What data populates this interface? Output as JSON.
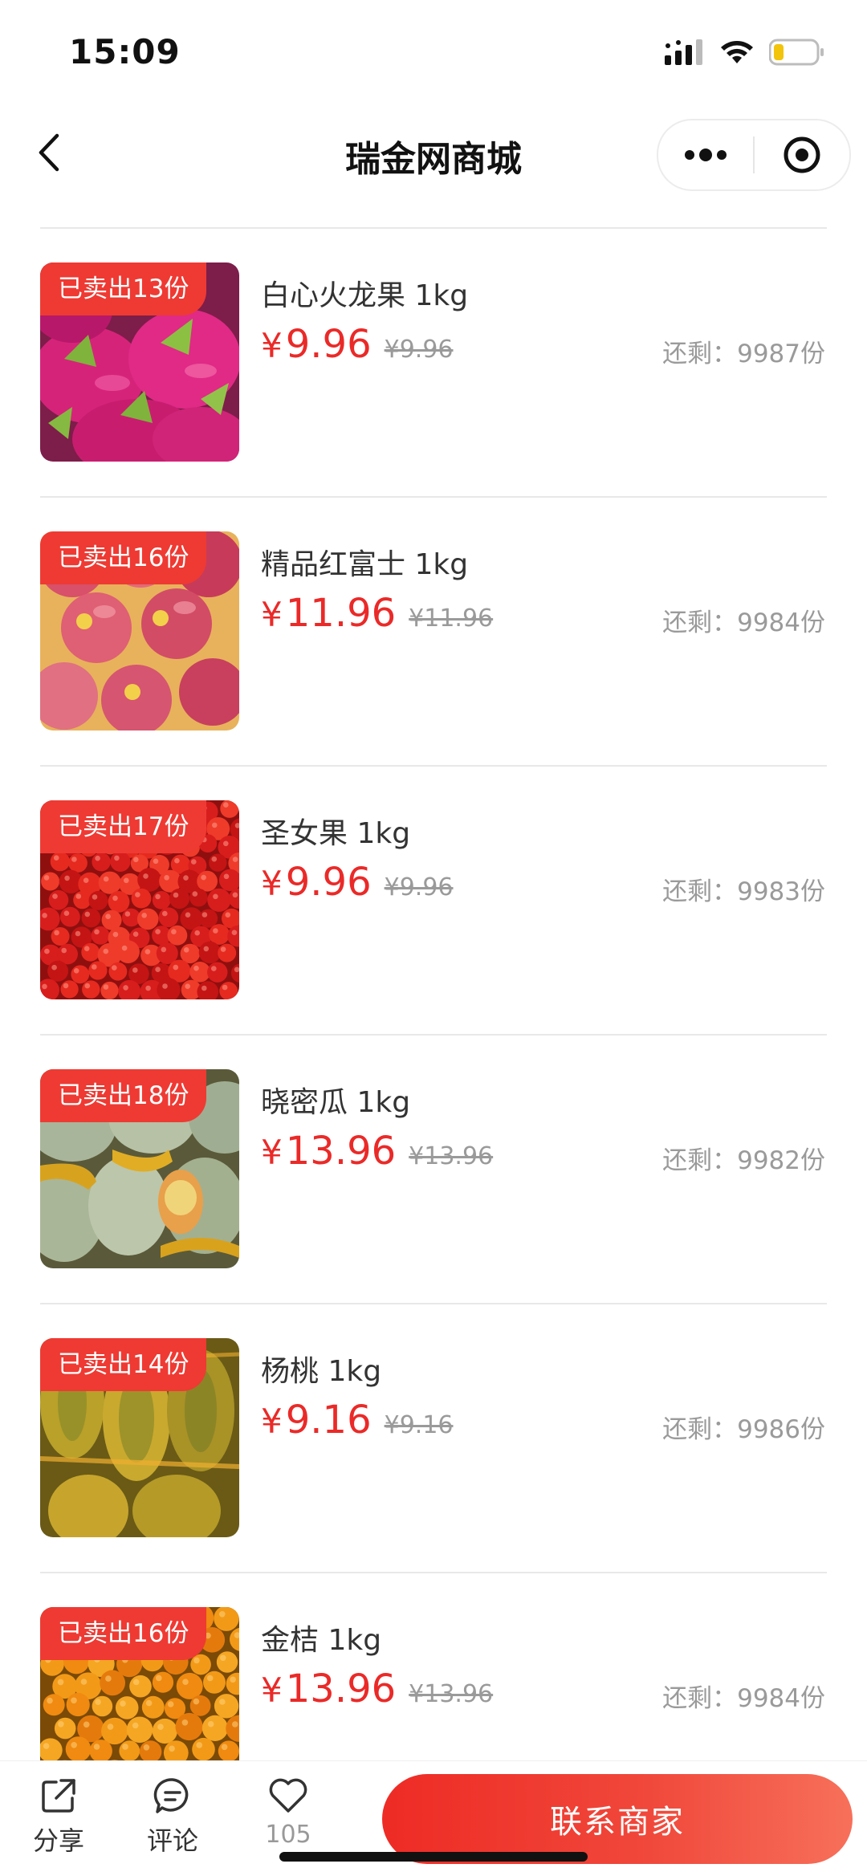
{
  "status_bar": {
    "time": "15:09"
  },
  "nav": {
    "title": "瑞金网商城",
    "more_icon": "more-dots-icon",
    "close_icon": "target-circle-icon",
    "back_icon": "chevron-left-icon"
  },
  "colors": {
    "accent": "#ea2a28",
    "badge": "#ee3a33",
    "muted": "#9a9a9a",
    "divider": "#e8e8e8"
  },
  "currency_symbol": "¥",
  "products": [
    {
      "sold": "已卖出13份",
      "name": "白心火龙果 1kg",
      "price": "9.96",
      "original_price": "¥9.96",
      "remaining": "还剩：9987份",
      "image": "dragon-fruit"
    },
    {
      "sold": "已卖出16份",
      "name": "精品红富士 1kg",
      "price": "11.96",
      "original_price": "¥11.96",
      "remaining": "还剩：9984份",
      "image": "apples"
    },
    {
      "sold": "已卖出17份",
      "name": "圣女果 1kg",
      "price": "9.96",
      "original_price": "¥9.96",
      "remaining": "还剩：9983份",
      "image": "cherry-tomatoes"
    },
    {
      "sold": "已卖出18份",
      "name": "晓密瓜 1kg",
      "price": "13.96",
      "original_price": "¥13.96",
      "remaining": "还剩：9982份",
      "image": "melons"
    },
    {
      "sold": "已卖出14份",
      "name": "杨桃 1kg",
      "price": "9.16",
      "original_price": "¥9.16",
      "remaining": "还剩：9986份",
      "image": "star-fruit"
    },
    {
      "sold": "已卖出16份",
      "name": "金桔 1kg",
      "price": "13.96",
      "original_price": "¥13.96",
      "remaining": "还剩：9984份",
      "image": "kumquats"
    }
  ],
  "bottom_bar": {
    "share_label": "分享",
    "comment_label": "评论",
    "like_count": "105",
    "contact_label": "联系商家"
  }
}
